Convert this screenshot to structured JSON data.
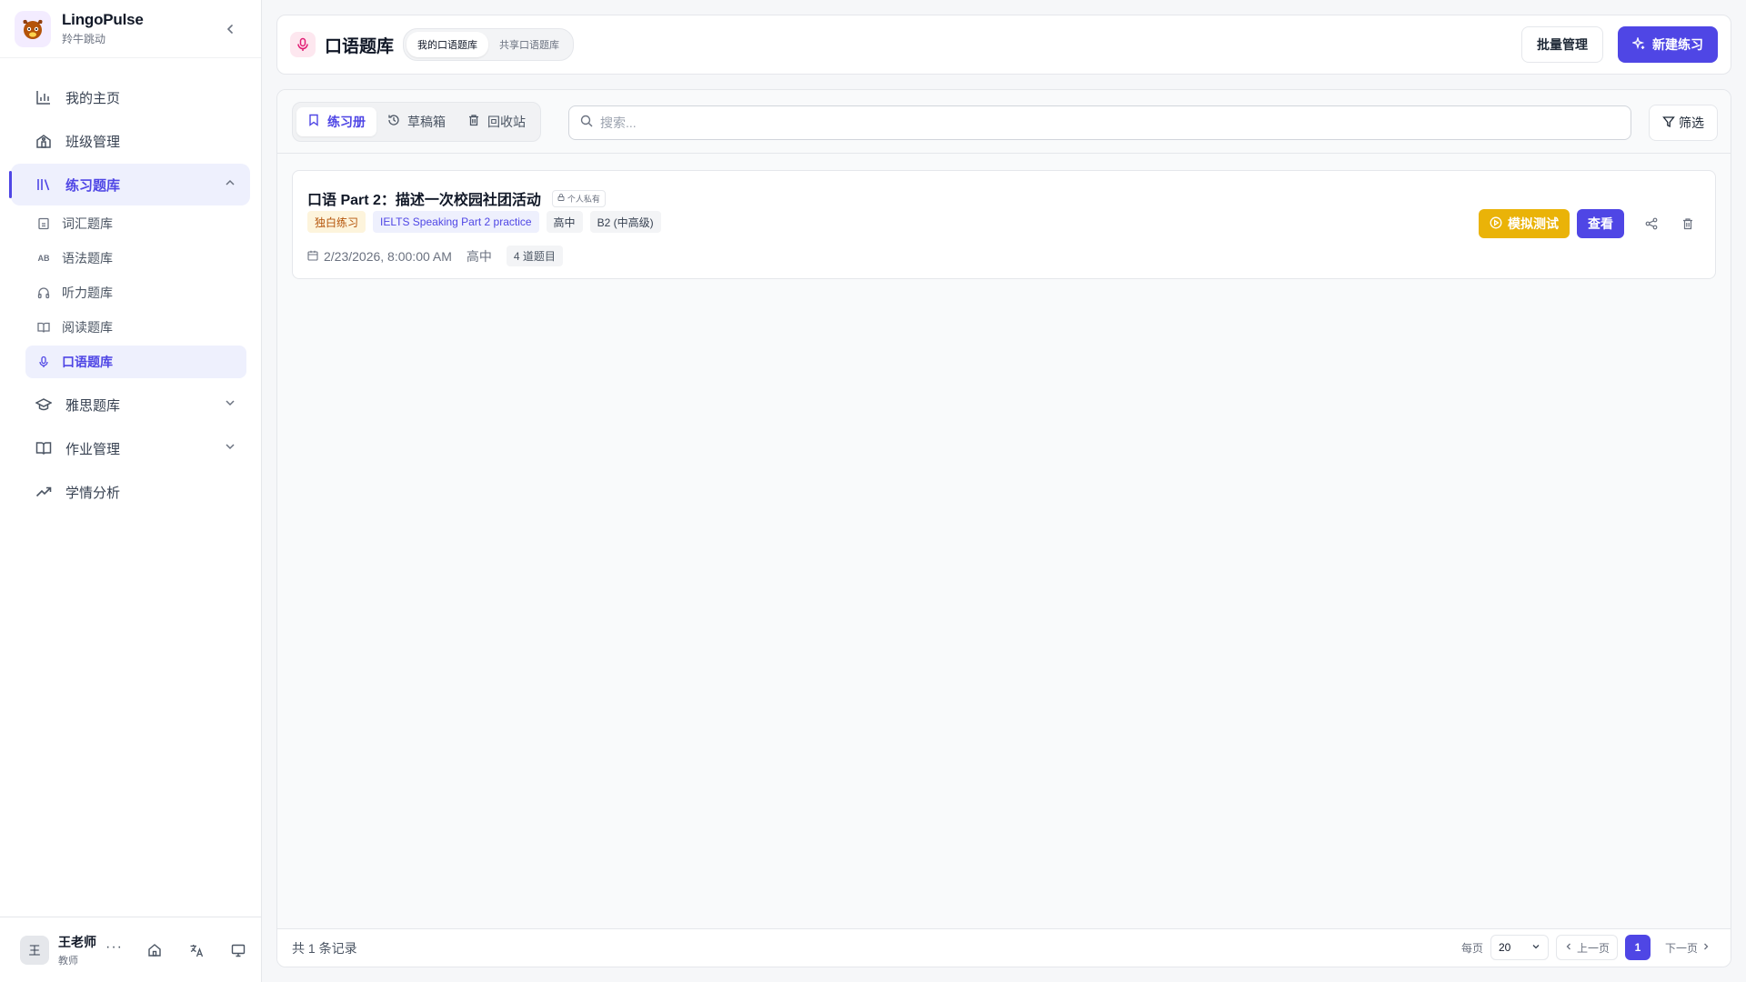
{
  "brand": {
    "name": "LingoPulse",
    "subtitle": "羚牛跳动"
  },
  "sidebar": {
    "items": [
      {
        "label": "我的主页",
        "icon": "bar-chart-icon"
      },
      {
        "label": "班级管理",
        "icon": "school-icon"
      },
      {
        "label": "练习题库",
        "icon": "library-icon",
        "active": true,
        "expanded": true
      },
      {
        "label": "雅思题库",
        "icon": "graduation-cap-icon"
      },
      {
        "label": "作业管理",
        "icon": "book-open-icon"
      },
      {
        "label": "学情分析",
        "icon": "trending-up-icon"
      }
    ],
    "sub_items": [
      {
        "label": "词汇题库",
        "icon": "file-icon"
      },
      {
        "label": "语法题库",
        "icon": "ab-icon",
        "glyph": "AB"
      },
      {
        "label": "听力题库",
        "icon": "headphones-icon"
      },
      {
        "label": "阅读题库",
        "icon": "book-icon"
      },
      {
        "label": "口语题库",
        "icon": "mic-icon",
        "active": true
      }
    ]
  },
  "user": {
    "avatar": "王",
    "name": "王老师",
    "role": "教师",
    "more": "···"
  },
  "header": {
    "title": "口语题库",
    "segments": [
      "我的口语题库",
      "共享口语题库"
    ],
    "batch_label": "批量管理",
    "new_label": "新建练习"
  },
  "toolbar": {
    "tabs": [
      "练习册",
      "草稿箱",
      "回收站"
    ],
    "search_placeholder": "搜索...",
    "filter_label": "筛选"
  },
  "items": [
    {
      "title": "口语 Part 2：描述一次校园社团活动",
      "privacy": "个人私有",
      "tags": [
        "独白练习",
        "IELTS Speaking Part 2 practice",
        "高中",
        "B2 (中高级)"
      ],
      "date": "2/23/2026, 8:00:00 AM",
      "level": "高中",
      "count": "4 道题目",
      "mock_label": "模拟测试",
      "view_label": "查看"
    }
  ],
  "footer": {
    "total": "共 1 条记录",
    "per_page_label": "每页",
    "per_page": "20",
    "prev": "上一页",
    "page": "1",
    "next": "下一页"
  },
  "colors": {
    "accent": "#4f46e5",
    "warning": "#eab308",
    "mic": "#e11d74"
  }
}
